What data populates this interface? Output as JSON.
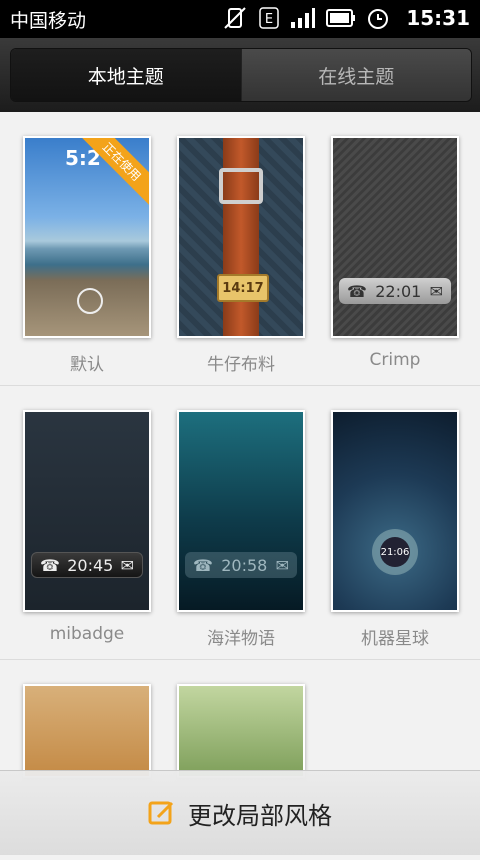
{
  "status_bar": {
    "carrier": "中国移动",
    "time": "15:31",
    "icons": [
      "vibrate-off-icon",
      "edge-data-icon",
      "signal-icon",
      "battery-icon",
      "alarm-icon"
    ]
  },
  "tabs": [
    {
      "label": "本地主题",
      "active": true
    },
    {
      "label": "在线主题",
      "active": false
    }
  ],
  "themes": [
    {
      "name": "默认",
      "badge": "正在使用",
      "lock_time": "5:2"
    },
    {
      "name": "牛仔布料",
      "lock_time": "14:17"
    },
    {
      "name": "Crimp",
      "lock_time": "22:01"
    },
    {
      "name": "mibadge",
      "lock_time": "20:45"
    },
    {
      "name": "海洋物语",
      "lock_time": "20:58"
    },
    {
      "name": "机器星球",
      "lock_time": "21:06"
    },
    {
      "name": ""
    },
    {
      "name": ""
    }
  ],
  "bottom_action": {
    "label": "更改局部风格",
    "icon": "edit-icon"
  },
  "colors": {
    "accent": "#f3a31a",
    "header_dark": "#1c1c1c",
    "caption": "#8a8a8a"
  }
}
